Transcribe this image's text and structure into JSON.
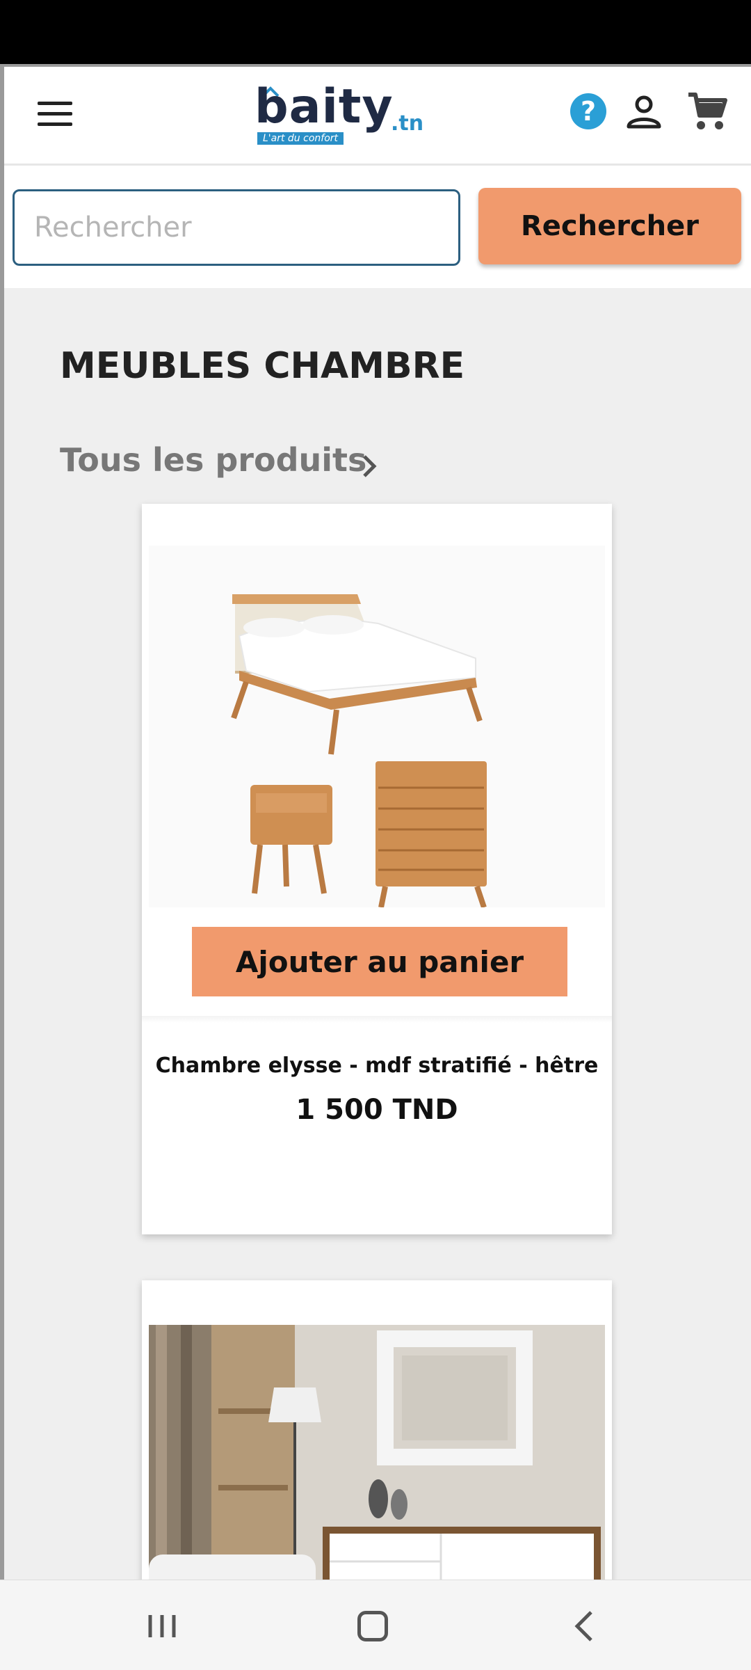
{
  "header": {
    "logo_text": "baity",
    "logo_tld": ".tn",
    "logo_tagline": "L'art du confort",
    "help_icon": "question-circle-icon",
    "user_icon": "user-icon",
    "cart_icon": "cart-icon"
  },
  "search": {
    "placeholder": "Rechercher",
    "button_label": "Rechercher"
  },
  "category": {
    "title": "MEUBLES CHAMBRE",
    "all_products_label": "Tous les produits"
  },
  "products": [
    {
      "name": "Chambre elysse - mdf stratifié - hêtre",
      "price": "1 500 TND",
      "add_to_cart_label": "Ajouter au panier"
    }
  ],
  "colors": {
    "accent": "#f19a6d",
    "brand_blue": "#2a8fc7",
    "brand_dark": "#1f2a44"
  }
}
